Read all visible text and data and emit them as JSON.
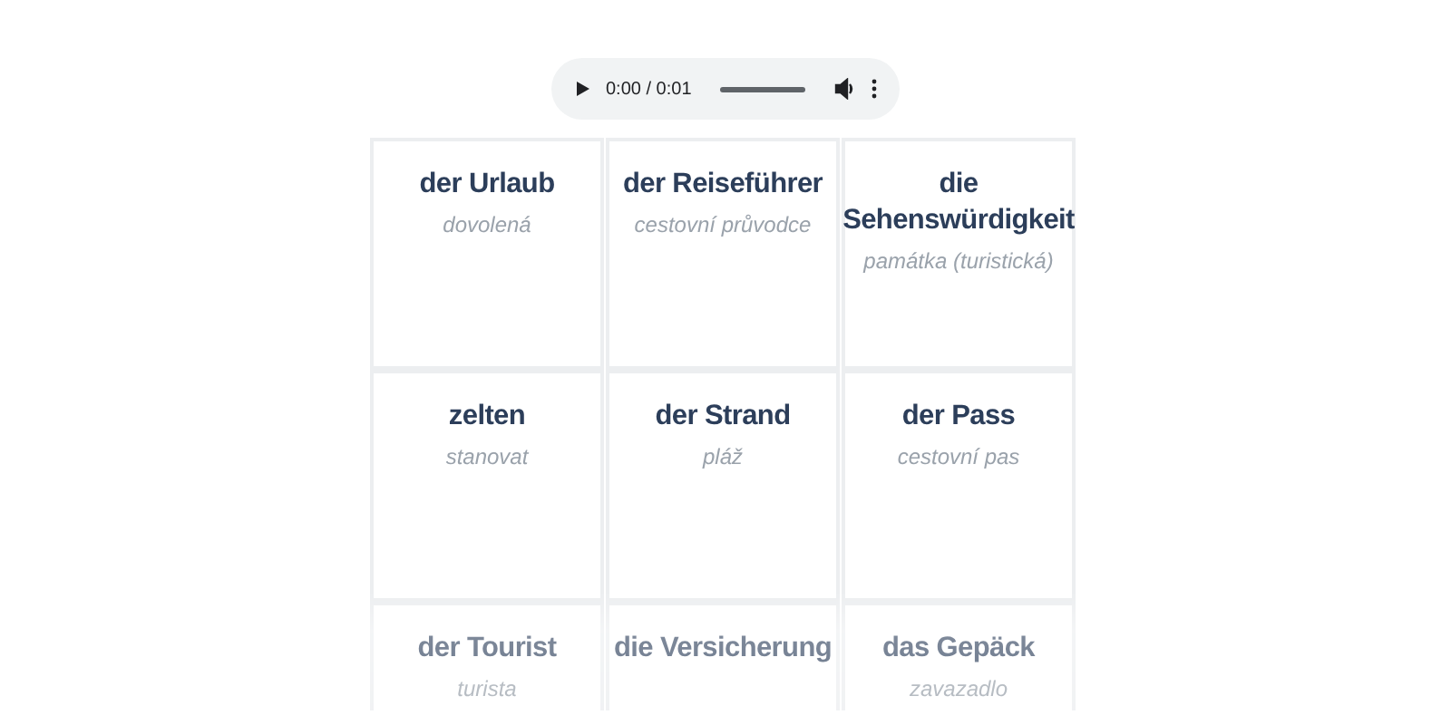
{
  "audio_player": {
    "time": "0:00 / 0:01"
  },
  "cards": [
    {
      "word": "der Urlaub",
      "translation": "dovolená"
    },
    {
      "word": "der Reiseführer",
      "translation": "cestovní průvodce"
    },
    {
      "word": "die Sehenswürdigkeit",
      "translation": "památka (turistická)"
    },
    {
      "word": "zelten",
      "translation": "stanovat"
    },
    {
      "word": "der Strand",
      "translation": "pláž"
    },
    {
      "word": "der Pass",
      "translation": "cestovní pas"
    },
    {
      "word": "der Tourist",
      "translation": "turista"
    },
    {
      "word": "die Versicherung"
    },
    {
      "word": "das Gepäck",
      "translation": "zavazadlo"
    }
  ]
}
